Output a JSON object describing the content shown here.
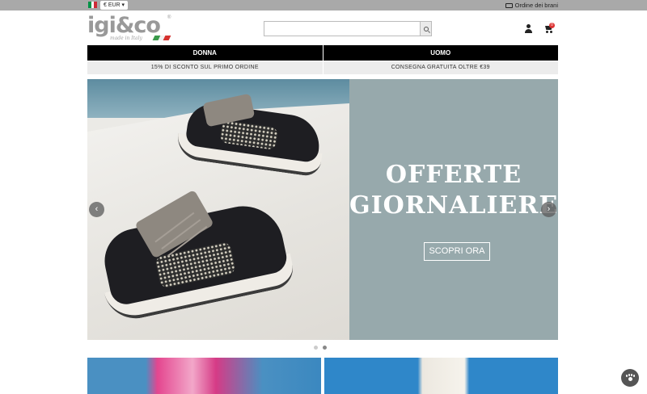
{
  "topbar": {
    "flag_colors": [
      "#009246",
      "#ffffff",
      "#ce2b37"
    ],
    "currency": "€ EUR ▾",
    "orders_label": "Ordine dei brani",
    "orders_icon": "truck-icon"
  },
  "header": {
    "logo_text": "igi&co",
    "logo_tagline": "made in Italy",
    "logo_reg": "®",
    "search_placeholder": "",
    "cart_count": "0"
  },
  "nav": {
    "items": [
      {
        "label": "DONNA"
      },
      {
        "label": "UOMO"
      }
    ]
  },
  "promo": {
    "items": [
      {
        "label": "15% DI SCONTO SUL PRIMO ORDINE"
      },
      {
        "label": "CONSEGNA GRATUITA OLTRE €39"
      }
    ]
  },
  "hero": {
    "title_line1": "OFFERTE",
    "title_line2": "GIORNALIERE",
    "cta_label": "SCOPRI ORA",
    "panel_color": "#97a9ac",
    "prev_arrow": "‹",
    "next_arrow": "›",
    "slide_count": 2,
    "active_slide": 2
  }
}
